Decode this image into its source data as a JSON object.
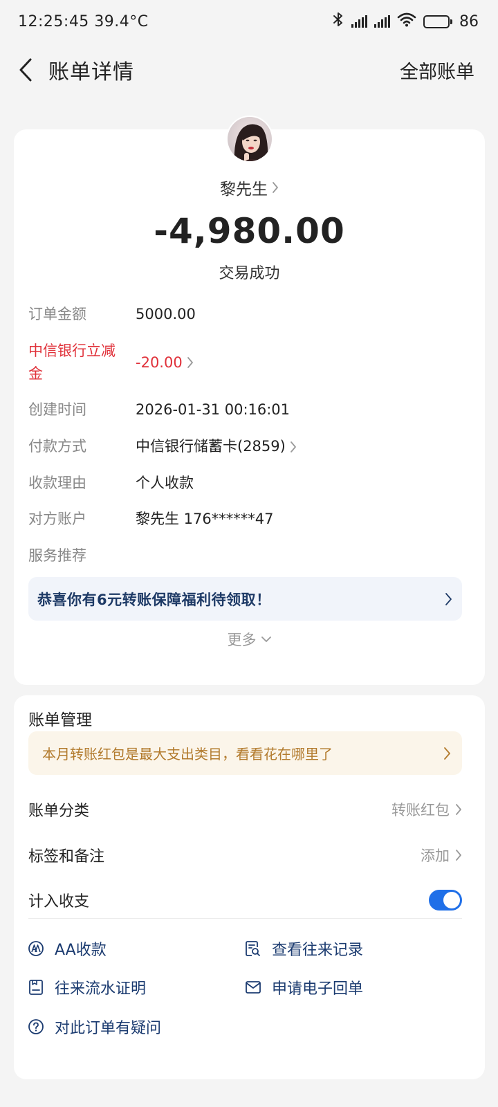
{
  "status_bar": {
    "time": "12:25:45",
    "temperature": "39.4°C",
    "battery": "86",
    "battery_level": 0.86
  },
  "nav": {
    "title": "账单详情",
    "right_link": "全部账单"
  },
  "transaction": {
    "payee": "黎先生",
    "amount": "-4,980.00",
    "status": "交易成功",
    "details": [
      {
        "label": "订单金额",
        "value": "5000.00"
      },
      {
        "label": "中信银行立减金",
        "value": "-20.00"
      },
      {
        "label": "创建时间",
        "value": "2026-01-31 00:16:01"
      },
      {
        "label": "付款方式",
        "value": "中信银行储蓄卡(2859)"
      },
      {
        "label": "收款理由",
        "value": "个人收款"
      },
      {
        "label": "对方账户",
        "value": "黎先生 176******47"
      },
      {
        "label": "服务推荐",
        "value": ""
      }
    ],
    "promo": "恭喜你有6元转账保障福利待领取！",
    "more_label": "更多"
  },
  "manage": {
    "title": "账单管理",
    "banner": "本月转账红包是最大支出类目，看看花在哪里了",
    "category": {
      "label": "账单分类",
      "value": "转账红包"
    },
    "tag_note": {
      "label": "标签和备注",
      "value": "添加"
    },
    "count_in": {
      "label": "计入收支",
      "enabled": true
    },
    "actions": {
      "aa": "AA收款",
      "history": "查看往来记录",
      "statement": "往来流水证明",
      "receipt": "申请电子回单",
      "question": "对此订单有疑问"
    }
  },
  "colors": {
    "accent_blue": "#1f6fe8",
    "link_navy": "#1b3b70",
    "discount_red": "#e0313a",
    "banner_orange_text": "#b27a2c"
  }
}
